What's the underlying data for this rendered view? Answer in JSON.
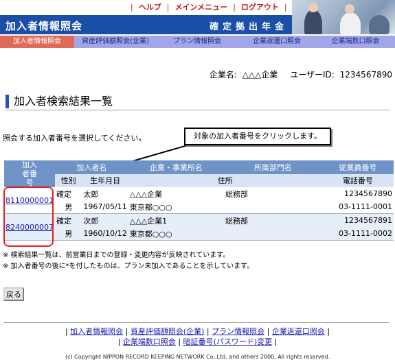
{
  "header": {
    "top_nav": [
      "ヘルプ",
      "メインメニュー",
      "ログアウト"
    ],
    "title": "加入者情報照会",
    "subtitle": "確定拠出年金"
  },
  "tabs": [
    {
      "label": "加入者情報照会",
      "active": true
    },
    {
      "label": "資産評価額照会(企業)",
      "active": false
    },
    {
      "label": "プラン情報照会",
      "active": false
    },
    {
      "label": "企業返還口照会",
      "active": false
    },
    {
      "label": "企業端数口照会",
      "active": false
    }
  ],
  "user_line": {
    "company_label": "企業名:",
    "company": "△△△企業",
    "user_label": "ユーザーID:",
    "user_id": "1234567890"
  },
  "page_title": "加入者検索結果一覧",
  "instruction": "照会する加入者番号を選択してください。",
  "callout": "対象の加入者番号をクリックします。",
  "table": {
    "headers_row1": [
      "加入者番号",
      "加入者名",
      "企業・事業所名",
      "所属部門名",
      "従業員番号"
    ],
    "headers_row2": [
      "性別",
      "生年月日",
      "住所",
      "電話番号"
    ],
    "rows": [
      {
        "id": "8110000001",
        "status": "確定",
        "name": "太郎",
        "company": "△△△企業",
        "dept": "総務部",
        "emp_no": "1234567890",
        "gender": "男",
        "birth": "1967/05/11",
        "address": "東京都○○○",
        "phone": "03-1111-0001"
      },
      {
        "id": "8240000007",
        "status": "確定",
        "name": "次郎",
        "company": "△△△企業1",
        "dept": "総務部",
        "emp_no": "1234567891",
        "gender": "男",
        "birth": "1960/10/12",
        "address": "東京都○○○",
        "phone": "03-1111-0002"
      }
    ]
  },
  "notes": [
    "※ 検索結果一覧は、前営業日までの登録・変更内容が反映されています。",
    "※ 加入者番号の後に*を付したものは、プラン未加入であることを示しています。"
  ],
  "back_label": "戻る",
  "footer": {
    "links_line1": [
      "加入者情報照会",
      "資産評価額照会(企業)",
      "プラン情報照会",
      "企業返還口照会"
    ],
    "links_line2": [
      "企業端数口照会",
      "暗証番号(パスワード)変更"
    ],
    "copyright": "(c) Copyright NIPPON RECORD KEEPING NETWORK Co.,Ltd. and others 2000. All rights reserved."
  }
}
